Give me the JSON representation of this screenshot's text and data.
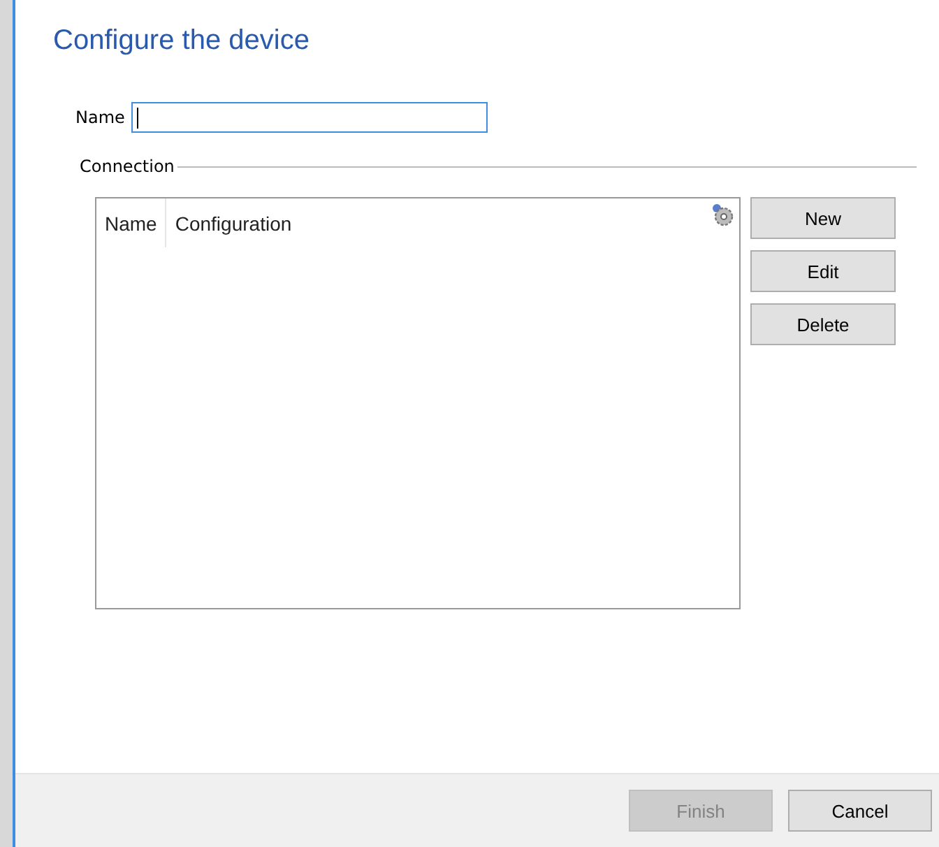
{
  "window": {
    "title": "Configure the device"
  },
  "name_field": {
    "label": "Name",
    "focused": true
  },
  "connection": {
    "legend": "Connection",
    "columns": [
      {
        "label": "Name"
      },
      {
        "label": "Configuration"
      }
    ],
    "buttons": [
      {
        "label": "New",
        "disabled": false
      },
      {
        "label": "Edit",
        "disabled": false
      },
      {
        "label": "Delete",
        "disabled": false
      }
    ]
  },
  "footer_buttons": [
    {
      "label": "Finish",
      "disabled": true
    },
    {
      "label": "Cancel",
      "disabled": false
    }
  ]
}
